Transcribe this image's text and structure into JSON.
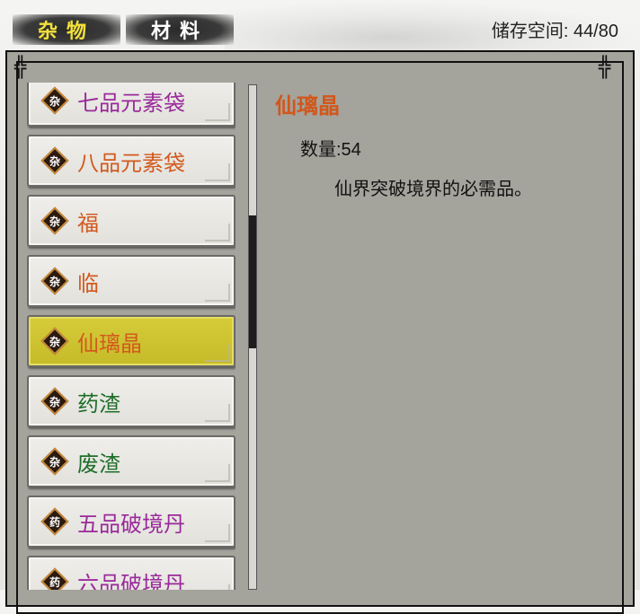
{
  "tabs": [
    {
      "label": "杂物",
      "active": true
    },
    {
      "label": "材料",
      "active": false
    }
  ],
  "storage": {
    "label": "储存空间: 44/80",
    "used": 44,
    "capacity": 80
  },
  "items": [
    {
      "badge": "杂",
      "name": "七品元素袋",
      "color": "#9a2a9a",
      "selected": false
    },
    {
      "badge": "杂",
      "name": "八品元素袋",
      "color": "#d25a1e",
      "selected": false
    },
    {
      "badge": "杂",
      "name": "福",
      "color": "#d25a1e",
      "selected": false
    },
    {
      "badge": "杂",
      "name": "临",
      "color": "#d25a1e",
      "selected": false
    },
    {
      "badge": "杂",
      "name": "仙璃晶",
      "color": "#d25a1e",
      "selected": true
    },
    {
      "badge": "杂",
      "name": "药渣",
      "color": "#1f6e2a",
      "selected": false
    },
    {
      "badge": "杂",
      "name": "废渣",
      "color": "#1f6e2a",
      "selected": false
    },
    {
      "badge": "药",
      "name": "五品破境丹",
      "color": "#9a2a9a",
      "selected": false
    },
    {
      "badge": "药",
      "name": "六品破境丹",
      "color": "#9a2a9a",
      "selected": false
    }
  ],
  "detail": {
    "title": "仙璃晶",
    "quantity": "数量:54",
    "description": "仙界突破境界的必需品。"
  },
  "colors": {
    "accent": "#d1571b",
    "panel": "#a4a39c",
    "selected": "#c8be2c",
    "tab_active_text": "#f3e13a"
  }
}
